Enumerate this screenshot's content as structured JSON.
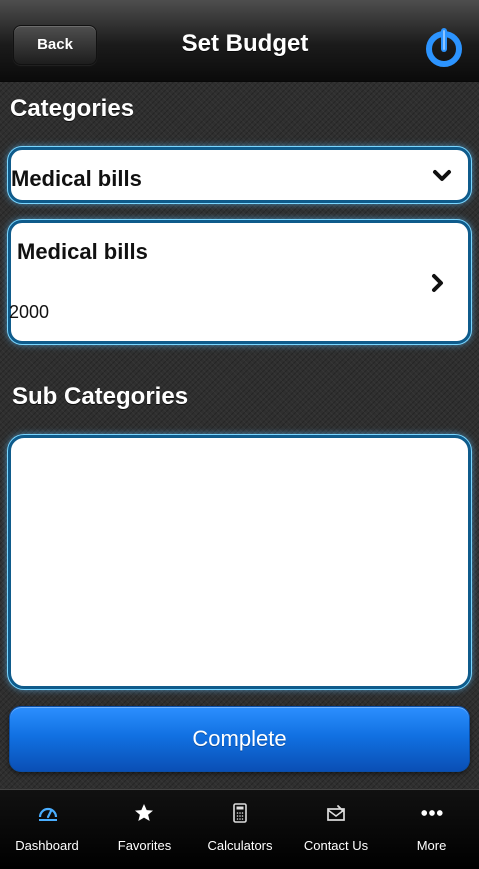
{
  "header": {
    "back_label": "Back",
    "title": "Set Budget",
    "power_icon": "power-icon",
    "accent_color": "#2a8bff"
  },
  "categories": {
    "heading": "Categories",
    "selected": "Medical bills",
    "dropdown_icon": "chevron-down-icon"
  },
  "budget_card": {
    "name": "Medical bills",
    "amount": "2000",
    "icon": "chevron-right-icon"
  },
  "subcategories": {
    "heading": "Sub Categories"
  },
  "actions": {
    "complete_label": "Complete",
    "button_color": "#1374e7"
  },
  "tabs": [
    {
      "label": "Dashboard",
      "icon": "dashboard-icon"
    },
    {
      "label": "Favorites",
      "icon": "star-icon"
    },
    {
      "label": "Calculators",
      "icon": "calculator-icon"
    },
    {
      "label": "Contact Us",
      "icon": "envelope-icon"
    },
    {
      "label": "More",
      "icon": "more-icon"
    }
  ]
}
